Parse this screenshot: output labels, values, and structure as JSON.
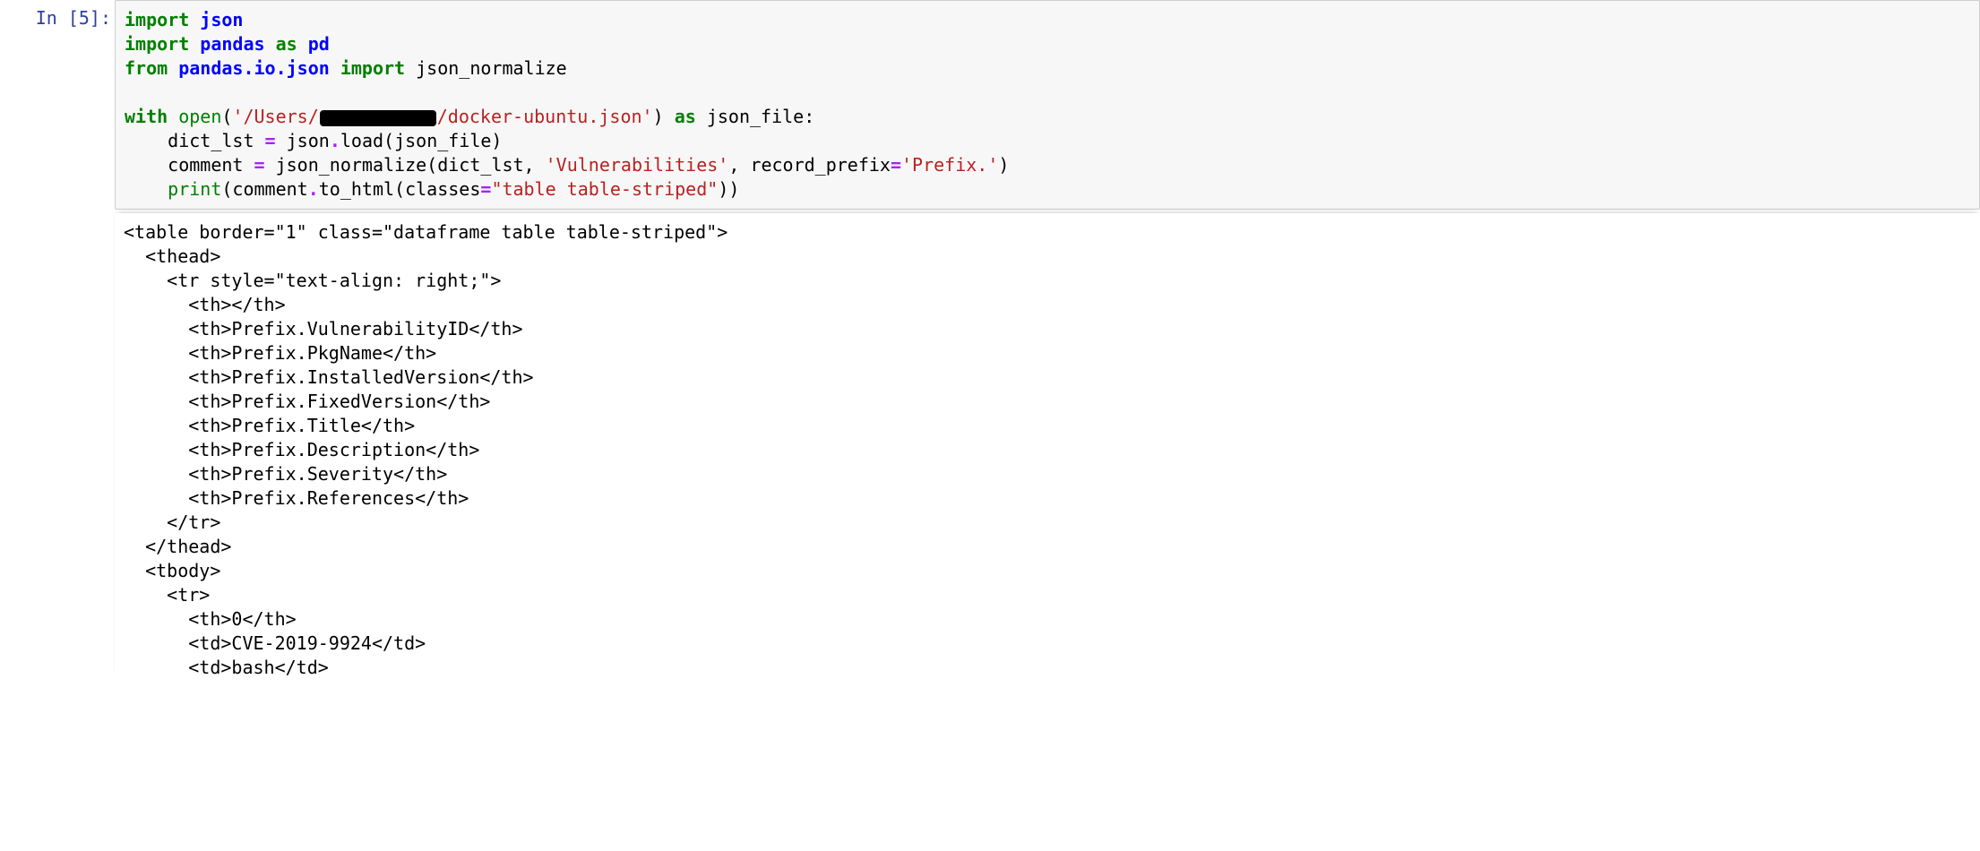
{
  "prompt": {
    "in_label": "In [5]:"
  },
  "code": {
    "kw_import1": "import",
    "mod_json": "json",
    "kw_import2": "import",
    "mod_pandas": "pandas",
    "kw_as1": "as",
    "alias_pd": "pd",
    "kw_from": "from",
    "mod_pandas_io_json": "pandas.io.json",
    "kw_import3": "import",
    "name_json_normalize": "json_normalize",
    "kw_with": "with",
    "fn_open": "open",
    "str_path_pre": "'/Users/",
    "str_path_post": "/docker-ubuntu.json'",
    "kw_as2": "as",
    "name_json_file": "json_file:",
    "line_dict_lst_a": "    dict_lst ",
    "op_eq1": "=",
    "line_dict_lst_b": " json",
    "op_dot1": ".",
    "line_dict_lst_c": "load(json_file)",
    "line_comment_a": "    comment ",
    "op_eq2": "=",
    "line_comment_b": " json_normalize(dict_lst, ",
    "str_vuln": "'Vulnerabilities'",
    "line_comment_c": ", record_prefix",
    "op_eq3": "=",
    "str_prefix": "'Prefix.'",
    "line_comment_d": ")",
    "line_print_a": "    ",
    "fn_print": "print",
    "line_print_b": "(comment",
    "op_dot2": ".",
    "line_print_c": "to_html(classes",
    "op_eq4": "=",
    "str_classes": "\"table table-striped\"",
    "line_print_d": "))"
  },
  "output_lines": [
    "<table border=\"1\" class=\"dataframe table table-striped\">",
    "  <thead>",
    "    <tr style=\"text-align: right;\">",
    "      <th></th>",
    "      <th>Prefix.VulnerabilityID</th>",
    "      <th>Prefix.PkgName</th>",
    "      <th>Prefix.InstalledVersion</th>",
    "      <th>Prefix.FixedVersion</th>",
    "      <th>Prefix.Title</th>",
    "      <th>Prefix.Description</th>",
    "      <th>Prefix.Severity</th>",
    "      <th>Prefix.References</th>",
    "    </tr>",
    "  </thead>",
    "  <tbody>",
    "    <tr>",
    "      <th>0</th>",
    "      <td>CVE-2019-9924</td>",
    "      <td>bash</td>"
  ]
}
